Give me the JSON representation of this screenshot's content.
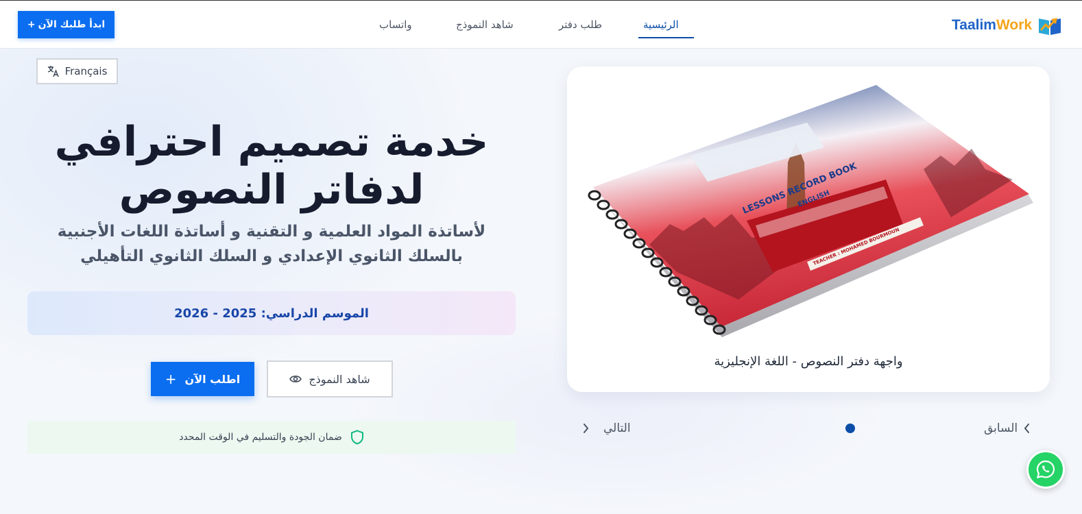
{
  "header": {
    "cta_label": "ابدأ طلبك الآن",
    "cta_plus": "+",
    "nav": [
      {
        "label": "الرئيسية",
        "active": true
      },
      {
        "label": "طلب دفتر",
        "active": false
      },
      {
        "label": "شاهد النموذج",
        "active": false
      },
      {
        "label": "واتساب",
        "active": false
      }
    ],
    "brand_part1": "Taalim",
    "brand_part2": "Work"
  },
  "language_button": {
    "label": "Français",
    "icon": "translate-icon"
  },
  "hero": {
    "title_line1": "خدمة تصميم احترافي",
    "title_line2": "لدفاتر النصوص",
    "subtitle_line1": "لأساتذة المواد العلمية و التقنية و أساتذة اللغات الأجنبية",
    "subtitle_line2": "بالسلك الثانوي الإعدادي و السلك الثانوي التأهيلي",
    "season": "الموسم الدراسي: 2025 - 2026",
    "order_button": "اطلب الآن",
    "order_plus": "+",
    "view_button": "شاهد النموذج",
    "quality_note": "ضمان الجودة والتسليم في الوقت المحدد"
  },
  "carousel": {
    "caption": "واجهة دفتر النصوص - اللغة الإنجليزية",
    "prev_label": "السابق",
    "next_label": "التالي",
    "book": {
      "title": "LESSONS RECORD BOOK",
      "subject": "ENGLISH",
      "teacher": "TEACHER : MOHAMED BOURMOUN"
    }
  },
  "colors": {
    "primary": "#0b6ef0",
    "nav_active": "#0b4ea8",
    "brand_blue": "#1f64c8",
    "brand_orange": "#f4a51a",
    "whatsapp": "#25d366"
  }
}
